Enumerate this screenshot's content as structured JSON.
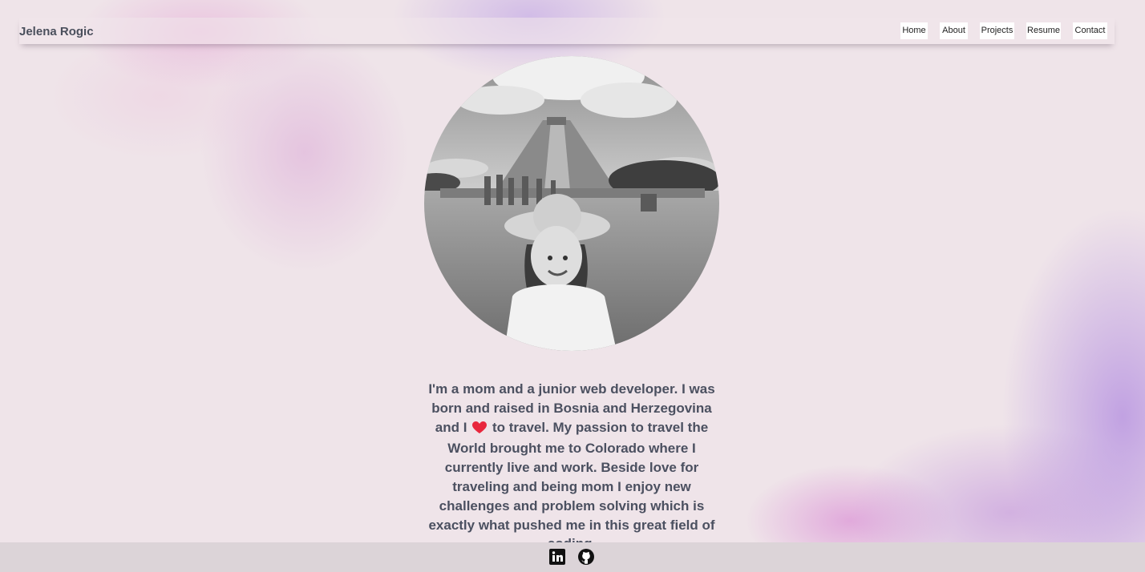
{
  "header": {
    "brand": "Jelena Rogic",
    "nav": [
      "Home",
      "About",
      "Projects",
      "Resume",
      "Contact"
    ]
  },
  "about": {
    "photo_icon": "portrait-photo",
    "bio_part1": "I'm a mom and a junior web developer. I was born and raised in Bosnia and Herzegovina and I",
    "heart_icon": "heart-emoji",
    "bio_part2": "to travel. My passion to travel the World brought me to Colorado where I currently live and work. Beside love for traveling and being mom I enjoy new challenges and problem solving which is exactly what pushed me in this great field of coding."
  },
  "footer": {
    "icons": [
      "linkedin-icon",
      "github-icon"
    ]
  },
  "colors": {
    "background": "#efe4e9",
    "text": "#4b5060",
    "footer": "#dcd4d8",
    "heart": "#e8273d"
  }
}
